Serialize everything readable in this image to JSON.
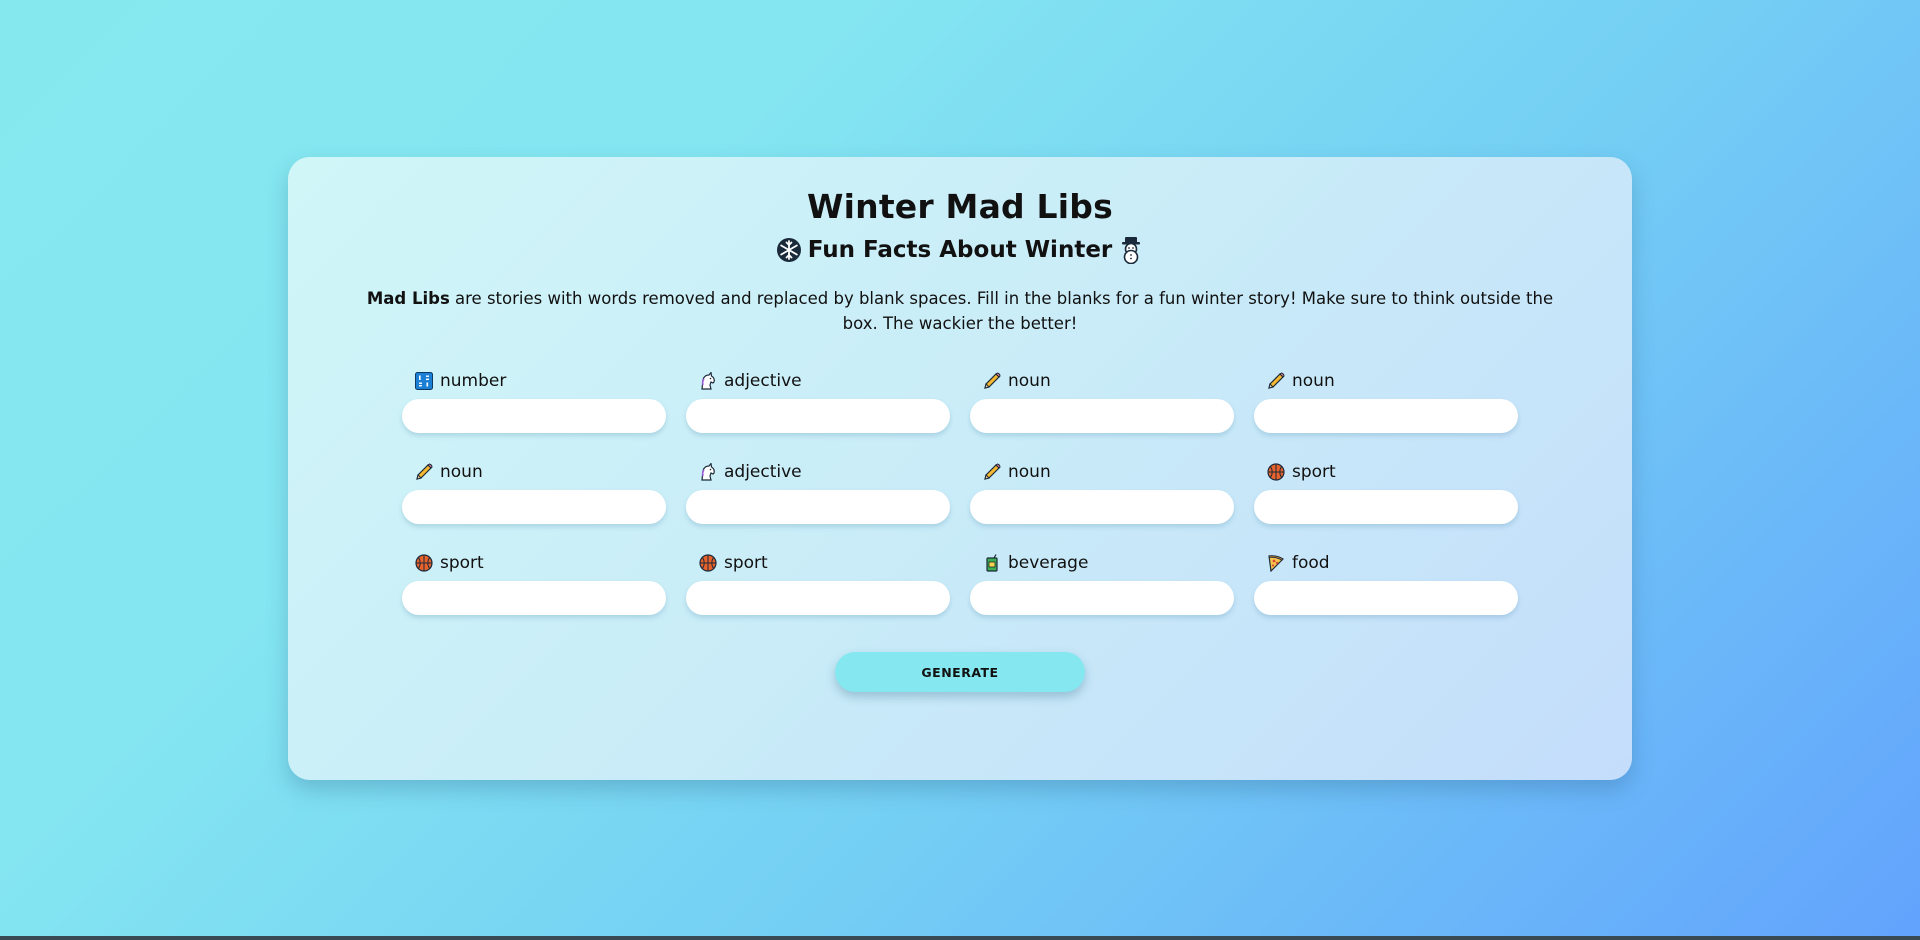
{
  "page": {
    "title": "Winter Mad Libs",
    "subtitle": "Fun Facts About Winter",
    "subtitle_left_icon": "snowflake-icon",
    "subtitle_right_icon": "snowman-icon",
    "intro_bold": "Mad Libs",
    "intro_rest": " are stories with words removed and replaced by blank spaces. Fill in the blanks for a fun winter story! Make sure to think outside the box. The wackier the better!"
  },
  "fields": [
    {
      "label": "number",
      "icon": "numbers-icon",
      "value": ""
    },
    {
      "label": "adjective",
      "icon": "unicorn-icon",
      "value": ""
    },
    {
      "label": "noun",
      "icon": "pencil-icon",
      "value": ""
    },
    {
      "label": "noun",
      "icon": "pencil-icon",
      "value": ""
    },
    {
      "label": "noun",
      "icon": "pencil-icon",
      "value": ""
    },
    {
      "label": "adjective",
      "icon": "unicorn-icon",
      "value": ""
    },
    {
      "label": "noun",
      "icon": "pencil-icon",
      "value": ""
    },
    {
      "label": "sport",
      "icon": "basketball-icon",
      "value": ""
    },
    {
      "label": "sport",
      "icon": "basketball-icon",
      "value": ""
    },
    {
      "label": "sport",
      "icon": "basketball-icon",
      "value": ""
    },
    {
      "label": "beverage",
      "icon": "juice-box-icon",
      "value": ""
    },
    {
      "label": "food",
      "icon": "pizza-icon",
      "value": ""
    }
  ],
  "actions": {
    "generate_label": "GENERATE"
  },
  "colors": {
    "button_bg": "#85e7f0",
    "input_bg": "#ffffff"
  }
}
